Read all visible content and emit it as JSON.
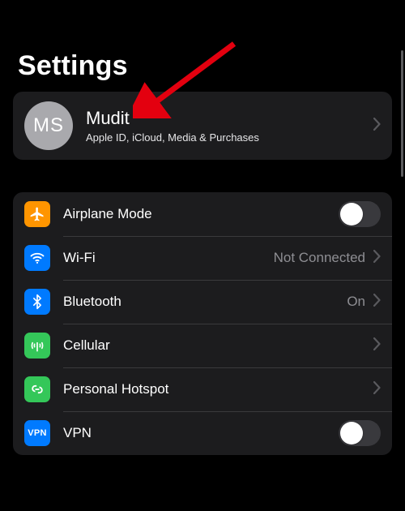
{
  "title": "Settings",
  "profile": {
    "initials": "MS",
    "name": "Mudit",
    "subtitle": "Apple ID, iCloud, Media & Purchases"
  },
  "rows": {
    "airplane": {
      "label": "Airplane Mode"
    },
    "wifi": {
      "label": "Wi-Fi",
      "value": "Not Connected"
    },
    "bluetooth": {
      "label": "Bluetooth",
      "value": "On"
    },
    "cellular": {
      "label": "Cellular"
    },
    "hotspot": {
      "label": "Personal Hotspot"
    },
    "vpn": {
      "label": "VPN",
      "badge": "VPN"
    }
  },
  "colors": {
    "airplane": "#ff9500",
    "wifi": "#007aff",
    "bluetooth": "#007aff",
    "cellular": "#34c759",
    "hotspot": "#34c759",
    "vpn": "#007aff"
  }
}
